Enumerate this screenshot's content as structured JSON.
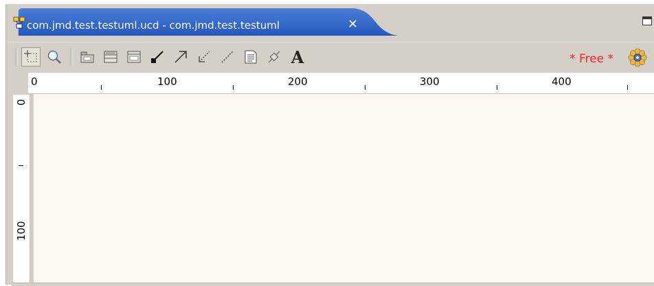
{
  "tab": {
    "title": "com.jmd.test.testuml.ucd - com.jmd.test.testuml",
    "close_glyph": "✕",
    "icon": "uml-diagram-icon"
  },
  "window": {
    "maximize_icon": "maximize-icon"
  },
  "toolbar": {
    "tools": [
      {
        "name": "select-tool",
        "icon": "marquee-select-icon",
        "selected": true
      },
      {
        "name": "zoom-tool",
        "icon": "magnifier-icon"
      },
      {
        "name": "package-tool",
        "icon": "package-icon"
      },
      {
        "name": "class-tool",
        "icon": "class-icon"
      },
      {
        "name": "interface-tool",
        "icon": "interface-icon"
      },
      {
        "name": "association-tool",
        "icon": "association-icon"
      },
      {
        "name": "inheritance-tool",
        "icon": "inheritance-arrow-icon"
      },
      {
        "name": "dependency-tool",
        "icon": "dependency-arrow-icon"
      },
      {
        "name": "link-tool",
        "icon": "dashed-line-icon"
      },
      {
        "name": "note-tool",
        "icon": "note-icon"
      },
      {
        "name": "note-link-tool",
        "icon": "note-link-icon"
      },
      {
        "name": "text-tool",
        "icon": "text-icon",
        "glyph": "A"
      }
    ],
    "free_label": "* Free *",
    "logo_icon": "omondo-flower-icon"
  },
  "ruler": {
    "horizontal_labels": [
      "0",
      "100",
      "200",
      "300",
      "400"
    ],
    "vertical_labels": [
      "0",
      "100"
    ]
  },
  "colors": {
    "tab_active": "#2d62c6",
    "free_text": "#ff2020",
    "canvas": "#fbf9f2",
    "chrome": "#d4d0c8"
  }
}
